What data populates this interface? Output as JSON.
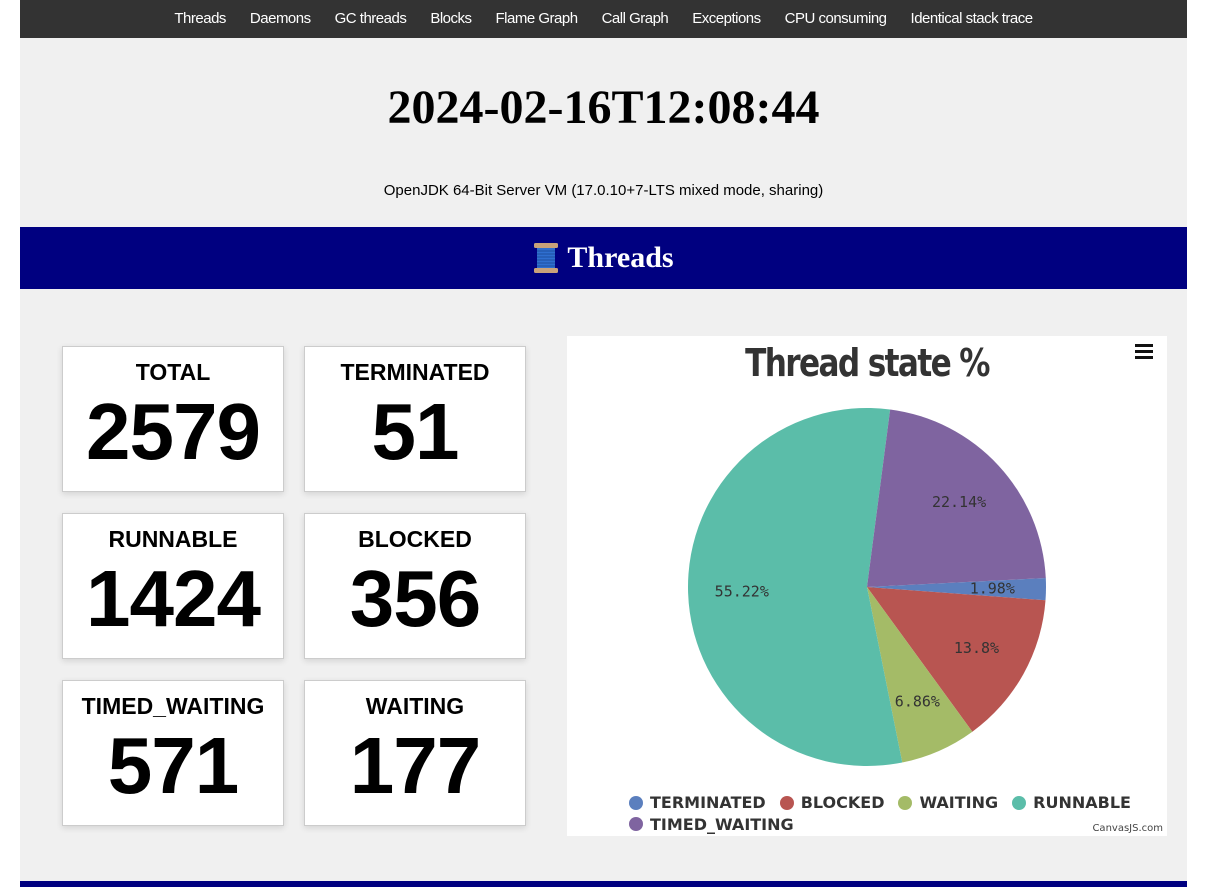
{
  "nav": {
    "items": [
      "Threads",
      "Daemons",
      "GC threads",
      "Blocks",
      "Flame Graph",
      "Call Graph",
      "Exceptions",
      "CPU consuming",
      "Identical stack trace"
    ]
  },
  "header": {
    "timestamp": "2024-02-16T12:08:44",
    "vm_info": "OpenJDK 64-Bit Server VM (17.0.10+7-LTS mixed mode, sharing)"
  },
  "section": {
    "title": "Threads",
    "icon": "spool-of-thread-icon"
  },
  "stats": [
    {
      "label": "TOTAL",
      "value": "2579"
    },
    {
      "label": "TERMINATED",
      "value": "51"
    },
    {
      "label": "RUNNABLE",
      "value": "1424"
    },
    {
      "label": "BLOCKED",
      "value": "356"
    },
    {
      "label": "TIMED_WAITING",
      "value": "571"
    },
    {
      "label": "WAITING",
      "value": "177"
    }
  ],
  "chart_data": {
    "type": "pie",
    "title": "Thread state %",
    "slices": [
      {
        "name": "TERMINATED",
        "value": 1.98,
        "label": "1.98%",
        "color": "#5b7fbe"
      },
      {
        "name": "BLOCKED",
        "value": 13.8,
        "label": "13.8%",
        "color": "#b85551"
      },
      {
        "name": "WAITING",
        "value": 6.86,
        "label": "6.86%",
        "color": "#a4bb67"
      },
      {
        "name": "RUNNABLE",
        "value": 55.22,
        "label": "55.22%",
        "color": "#5bbda9"
      },
      {
        "name": "TIMED_WAITING",
        "value": 22.14,
        "label": "22.14%",
        "color": "#7f64a0"
      }
    ],
    "legend_position": "bottom",
    "credit": "CanvasJS.com"
  },
  "colors": {
    "nav_bg": "#333333",
    "banner_bg": "#000080"
  }
}
